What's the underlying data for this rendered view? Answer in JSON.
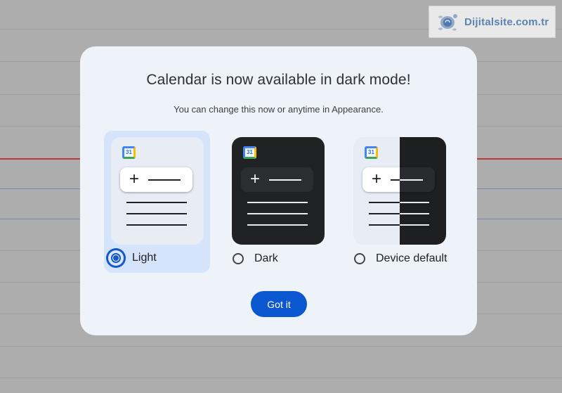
{
  "watermark": {
    "text": "Dijitalsite.com.tr"
  },
  "dialog": {
    "title": "Calendar is now available in dark mode!",
    "subtitle": "You can change this now or anytime in Appearance.",
    "calendar_icon_number": "31",
    "options": [
      {
        "label": "Light",
        "selected": true
      },
      {
        "label": "Dark",
        "selected": false
      },
      {
        "label": "Device default",
        "selected": false
      }
    ],
    "confirm_button": "Got it"
  },
  "colors": {
    "accent": "#0b57d0",
    "dialog_bg": "#eef3fa",
    "selected_option_bg": "#d5e3fb",
    "dark_preview": "#212224",
    "page_overlay": "#adadad"
  }
}
